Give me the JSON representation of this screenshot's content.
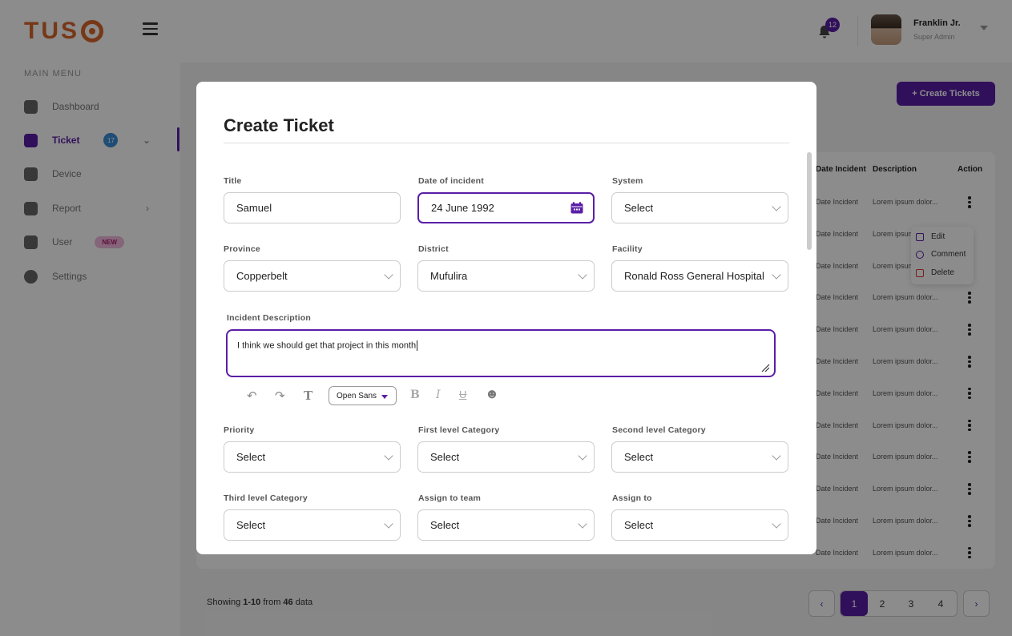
{
  "brand": {
    "logo_text": "TUS"
  },
  "header": {
    "notification_count": "12",
    "user_name": "Franklin Jr.",
    "user_role": "Super Admin"
  },
  "sidebar": {
    "menu_title": "MAIN MENU",
    "items": [
      {
        "label": "Dashboard",
        "icon": "dashboard-icon"
      },
      {
        "label": "Ticket",
        "icon": "ticket-icon",
        "badge": "17"
      },
      {
        "label": "Device",
        "icon": "device-icon"
      },
      {
        "label": "Report",
        "icon": "report-icon"
      },
      {
        "label": "User",
        "icon": "user-icon",
        "badge": "NEW"
      },
      {
        "label": "Settings",
        "icon": "gear-icon"
      }
    ]
  },
  "page": {
    "create_button": "+ Create Tickets"
  },
  "table": {
    "headers": [
      "Date Incident",
      "Description",
      "Action"
    ],
    "row_date": "Date Incident",
    "row_desc": "Lorem ipsum dolor...",
    "rows": 12
  },
  "context_menu": {
    "edit": "Edit",
    "comment": "Comment",
    "delete": "Delete"
  },
  "pagination": {
    "prefix": "Showing ",
    "range": "1-10",
    "middle": " from ",
    "total": "46",
    "suffix": " data",
    "pages": [
      "1",
      "2",
      "3",
      "4"
    ],
    "active_page": "1"
  },
  "modal": {
    "title": "Create Ticket",
    "fields": {
      "title": {
        "label": "Title",
        "value": "Samuel"
      },
      "date": {
        "label": "Date of incident",
        "value": "24 June 1992"
      },
      "system": {
        "label": "System",
        "value": "Select"
      },
      "province": {
        "label": "Province",
        "value": "Copperbelt"
      },
      "district": {
        "label": "District",
        "value": "Mufulira"
      },
      "facility": {
        "label": "Facility",
        "value": "Ronald Ross General Hospital"
      },
      "description": {
        "label": "Incident Description",
        "value": "I think we should get that project in this month"
      },
      "priority": {
        "label": "Priority",
        "value": "Select"
      },
      "cat1": {
        "label": "First level Category",
        "value": "Select"
      },
      "cat2": {
        "label": "Second level Category",
        "value": "Select"
      },
      "cat3": {
        "label": "Third level Category",
        "value": "Select"
      },
      "team": {
        "label": "Assign to team",
        "value": "Select"
      },
      "assignee": {
        "label": "Assign to",
        "value": "Select"
      }
    },
    "editor": {
      "font": "Open Sans"
    }
  },
  "colors": {
    "accent": "#5a1ea7",
    "brand": "#d9662b"
  }
}
